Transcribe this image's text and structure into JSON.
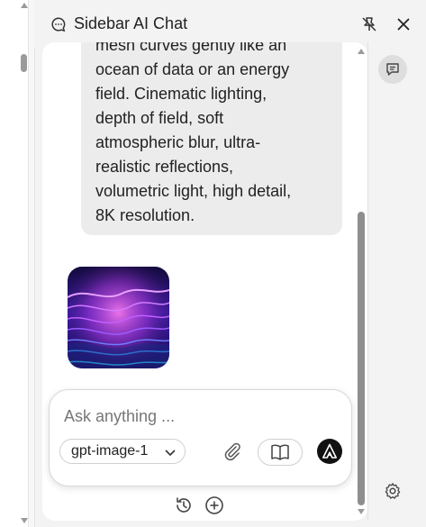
{
  "header": {
    "title": "Sidebar AI Chat",
    "icons": [
      "chat-bubble-icon",
      "unpin-icon",
      "close-icon"
    ]
  },
  "conversation": {
    "user_message": "mesh curves gently like an\nocean of data or an energy\nfield. Cinematic lighting,\ndepth of field, soft\natmospheric blur, ultra-\nrealistic reflections,\nvolumetric light, high detail,\n8K resolution.",
    "generated_image": {
      "alt": "",
      "colors": [
        "#1a0d55",
        "#5b2bd1",
        "#d13bd8",
        "#2bb8ff"
      ]
    }
  },
  "composer": {
    "placeholder": "Ask anything ...",
    "value": "",
    "model": "gpt-image-1",
    "icons": [
      "paperclip-icon",
      "book-icon",
      "send-icon"
    ]
  },
  "footer": {
    "icons": [
      "history-icon",
      "new-chat-icon"
    ]
  },
  "rail": {
    "icons": [
      "chat-icon",
      "gear-icon"
    ]
  },
  "colors": {
    "background": "#f3f3f3",
    "panel": "#ffffff",
    "bubble": "#ececec",
    "send_button": "#111111"
  }
}
